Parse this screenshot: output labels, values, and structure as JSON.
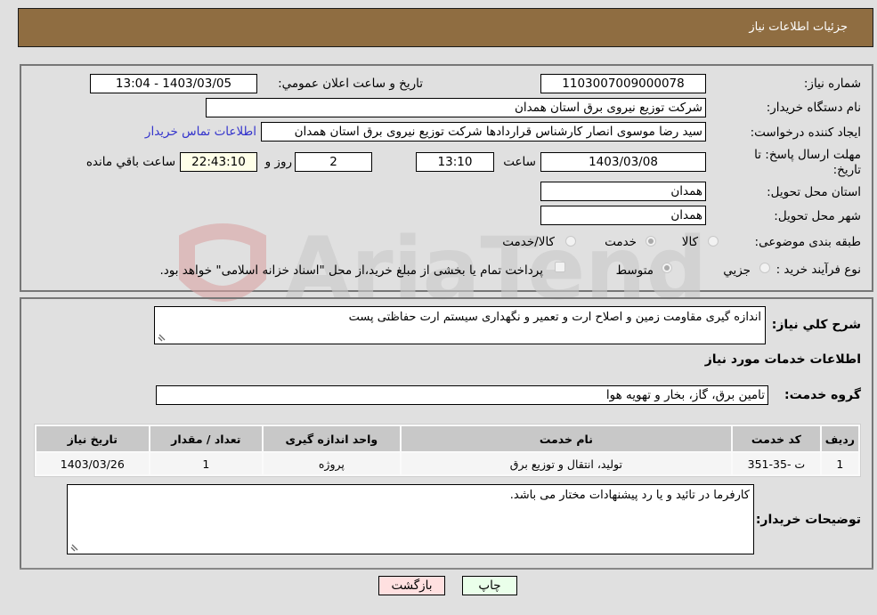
{
  "header": {
    "title": "جزئیات اطلاعات نیاز"
  },
  "details": {
    "need_number_label": "شماره نیاز:",
    "need_number": "1103007009000078",
    "announce_datetime_label": "تاريخ و ساعت اعلان عمومي:",
    "announce_datetime": "1403/03/05 - 13:04",
    "buyer_org_label": "نام دستگاه خريدار:",
    "buyer_org": "شرکت توزیع نیروی برق استان همدان",
    "requester_label": "ايجاد کننده درخواست:",
    "requester": "سید رضا موسوی انصار کارشناس قراردادها شرکت توزیع نیروی برق استان همدان",
    "buyer_contact_link": "اطلاعات تماس خريدار",
    "deadline_label": "مهلت ارسال پاسخ: تا تاريخ:",
    "deadline_date": "1403/03/08",
    "deadline_time_label": "ساعت",
    "deadline_time": "13:10",
    "days_remaining": "2",
    "days_label": "روز و",
    "time_remaining": "22:43:10",
    "time_remaining_label": "ساعت باقي مانده",
    "delivery_province_label": "استان محل تحويل:",
    "delivery_province": "همدان",
    "delivery_city_label": "شهر محل تحويل:",
    "delivery_city": "همدان",
    "category_label": "طبقه بندی موضوعی:",
    "category_options": [
      {
        "label": "کالا",
        "selected": false
      },
      {
        "label": "خدمت",
        "selected": true
      },
      {
        "label": "کالا/خدمت",
        "selected": false
      }
    ],
    "process_label": "نوع فرآيند خريد :",
    "process_options": [
      {
        "label": "جزيي",
        "selected": false
      },
      {
        "label": "متوسط",
        "selected": true
      }
    ],
    "treasury_note": "پرداخت تمام يا بخشی از مبلغ خريد،از محل \"اسناد خزانه اسلامی\" خواهد بود.",
    "treasury_checked": false
  },
  "description": {
    "label": "شرح کلي نياز:",
    "text": "اندازه گیری مقاومت زمین و اصلاح ارت و تعمیر و نگهداری سیستم ارت حفاظتی پست"
  },
  "services": {
    "section_title": "اطلاعات خدمات مورد نياز",
    "group_label": "گروه خدمت:",
    "group_value": "تامين برق، گاز، بخار و تهويه هوا",
    "table": {
      "headers": [
        "رديف",
        "کد خدمت",
        "نام خدمت",
        "واحد اندازه گيری",
        "تعداد / مقدار",
        "تاريخ نياز"
      ],
      "rows": [
        [
          "1",
          "ت -35-351",
          "توليد، انتقال و توزيع برق",
          "پروژه",
          "1",
          "1403/03/26"
        ]
      ]
    }
  },
  "buyer_notes": {
    "label": "توضيحات خريدار:",
    "text": "کارفرما در تائيد و يا رد پيشنهادات مختار می باشد."
  },
  "buttons": {
    "print": "چاپ",
    "back": "بازگشت"
  },
  "watermark": {
    "text": "AriaTender.neT"
  },
  "colors": {
    "header_bg": "#8f6d41",
    "link": "#3333cc",
    "back_btn_bg": "#ffe0e0",
    "print_btn_bg": "#eaffea"
  }
}
